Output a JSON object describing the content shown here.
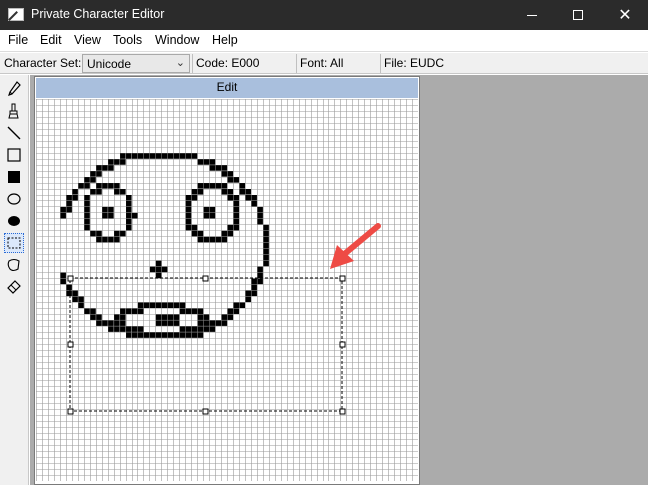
{
  "window": {
    "title": "Private Character Editor",
    "controls": {
      "minimize": "—",
      "maximize": "☐",
      "close": "✕"
    }
  },
  "menu": [
    "File",
    "Edit",
    "View",
    "Tools",
    "Window",
    "Help"
  ],
  "status": {
    "charset_label": "Character Set:",
    "charset_value": "Unicode",
    "code": "Code: E000",
    "font": "Font: All",
    "file": "File: EUDC"
  },
  "tools": [
    {
      "name": "pencil-icon",
      "selected": false
    },
    {
      "name": "brush-icon",
      "selected": false
    },
    {
      "name": "line-icon",
      "selected": false
    },
    {
      "name": "hollow-rectangle-icon",
      "selected": false
    },
    {
      "name": "filled-rectangle-icon",
      "selected": false
    },
    {
      "name": "hollow-ellipse-icon",
      "selected": false
    },
    {
      "name": "filled-ellipse-icon",
      "selected": false
    },
    {
      "name": "rectangular-selection-icon",
      "selected": true
    },
    {
      "name": "freeform-selection-icon",
      "selected": false
    },
    {
      "name": "eraser-icon",
      "selected": false
    }
  ],
  "editor": {
    "caption": "Edit",
    "grid_size": 64
  },
  "colors": {
    "titlebar": "#2b2b2b",
    "caption": "#a9bfdd",
    "workspace": "#ababab",
    "arrow": "#ee4b45",
    "pixel": "#000000"
  }
}
